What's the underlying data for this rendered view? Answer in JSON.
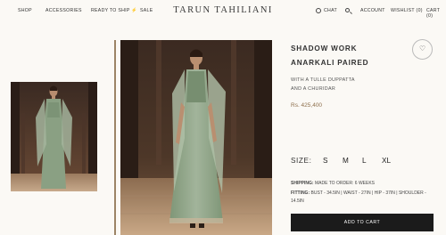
{
  "nav": {
    "left": [
      "SHOP",
      "ACCESSORIES",
      "READY TO SHIP ⚡",
      "SALE"
    ],
    "brand": "TARUN TAHILIANI",
    "right": [
      "CHAT",
      "ACCOUNT",
      "WISHLIST (0)",
      "CART (0)"
    ]
  },
  "product": {
    "title_line1": "SHADOW WORK",
    "title_line2": "ANARKALI PAIRED",
    "desc_line1": "WITH A TULLE DUPPATTA",
    "desc_line2": "AND A CHURIDAR",
    "price": "Rs. 425,400",
    "size_label": "SIZE:",
    "sizes": [
      "S",
      "M",
      "L",
      "XL"
    ],
    "shipping_label": "SHIPPING:",
    "shipping_value": "MADE TO ORDER: 6 WEEKS",
    "fitting_label": "FITTING:",
    "fitting_value": "BUST - 34.5IN | WAIST - 27IN | HIP - 37IN | SHOULDER - 14.5IN",
    "add_to_cart": "ADD TO CART"
  },
  "colors": {
    "accent": "#8d6e4b",
    "button": "#1b1b1b",
    "background": "#fbf9f5"
  }
}
